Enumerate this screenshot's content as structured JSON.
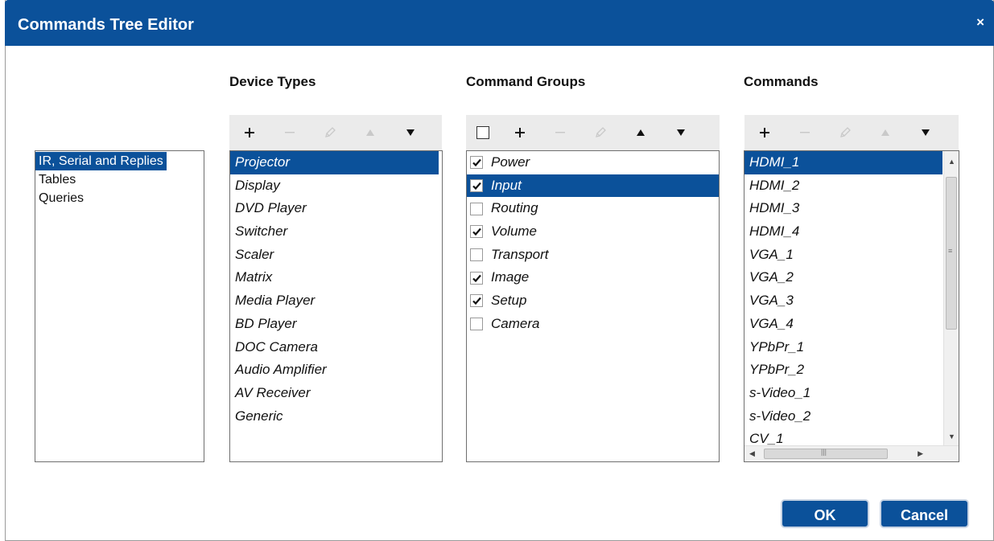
{
  "dialog": {
    "title": "Commands Tree Editor",
    "close_glyph": "×",
    "ok_label": "OK",
    "cancel_label": "Cancel"
  },
  "nav": {
    "items": [
      "IR, Serial and Replies",
      "Tables",
      "Queries"
    ],
    "selected": 0
  },
  "device_types": {
    "heading": "Device Types",
    "toolbar": [
      "plus-icon",
      "minus-icon",
      "edit-icon",
      "move-up-icon",
      "move-down-icon"
    ],
    "items": [
      "Projector",
      "Display",
      "DVD Player",
      "Switcher",
      "Scaler",
      "Matrix",
      "Media Player",
      "BD Player",
      "DOC Camera",
      "Audio Amplifier",
      "AV Receiver",
      "Generic"
    ],
    "selected": 0
  },
  "command_groups": {
    "heading": "Command Groups",
    "toolbar": [
      "select-all-checkbox",
      "plus-icon",
      "minus-icon",
      "edit-icon",
      "move-up-icon",
      "move-down-icon"
    ],
    "items": [
      {
        "label": "Power",
        "checked": true
      },
      {
        "label": "Input",
        "checked": true
      },
      {
        "label": "Routing",
        "checked": false
      },
      {
        "label": "Volume",
        "checked": true
      },
      {
        "label": "Transport",
        "checked": false
      },
      {
        "label": "Image",
        "checked": true
      },
      {
        "label": "Setup",
        "checked": true
      },
      {
        "label": "Camera",
        "checked": false
      }
    ],
    "selected": 1
  },
  "commands": {
    "heading": "Commands",
    "toolbar": [
      "plus-icon",
      "minus-icon",
      "edit-icon",
      "move-up-icon",
      "move-down-icon"
    ],
    "items": [
      "HDMI_1",
      "HDMI_2",
      "HDMI_3",
      "HDMI_4",
      "VGA_1",
      "VGA_2",
      "VGA_3",
      "VGA_4",
      "YPbPr_1",
      "YPbPr_2",
      "s-Video_1",
      "s-Video_2",
      "CV_1"
    ],
    "selected": 0
  },
  "colors": {
    "accent": "#0b519a",
    "toolbar_bg": "#ebebeb"
  }
}
